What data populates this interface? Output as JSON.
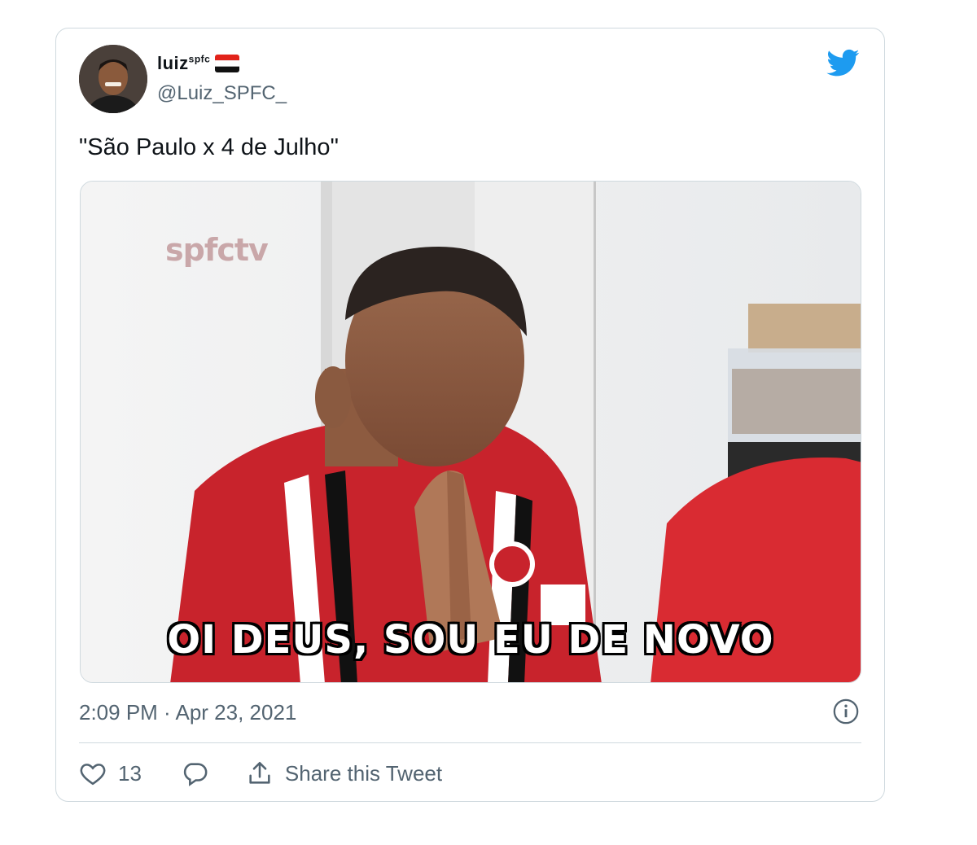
{
  "tweet": {
    "display_name": "luiz",
    "display_name_sup": "spfc",
    "handle": "@Luiz_SPFC_",
    "text": "\"São Paulo x 4 de Julho\"",
    "timestamp": "2:09 PM · Apr 23, 2021",
    "likes": "13",
    "share_label": "Share this Tweet"
  },
  "media": {
    "watermark": "spfctv",
    "caption": "OI DEUS, SOU EU DE NOVO"
  },
  "icons": {
    "bird": "twitter-bird-icon",
    "info": "info-icon",
    "like": "heart-icon",
    "reply": "reply-icon",
    "share": "share-icon"
  },
  "colors": {
    "brand": "#1d9bf0",
    "muted": "#536471",
    "border": "#cfd9de"
  }
}
